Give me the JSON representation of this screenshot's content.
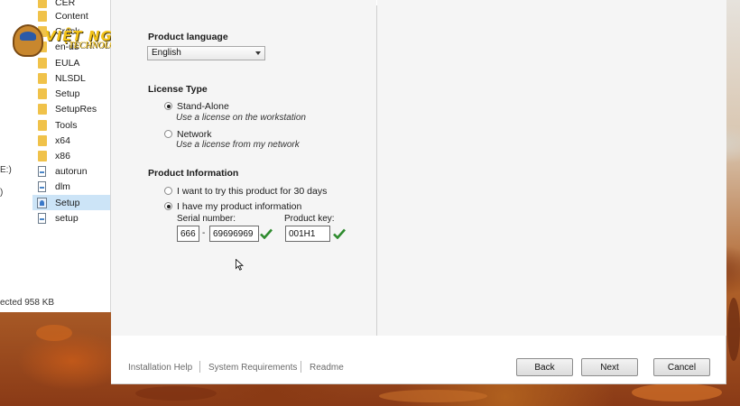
{
  "explorer": {
    "items": [
      {
        "label": "CER",
        "icon": "folder-icon"
      },
      {
        "label": "Content",
        "icon": "folder-icon"
      },
      {
        "label": "Crack",
        "icon": "folder-icon"
      },
      {
        "label": "en-us",
        "icon": "folder-icon"
      },
      {
        "label": "EULA",
        "icon": "folder-icon"
      },
      {
        "label": "NLSDL",
        "icon": "folder-icon"
      },
      {
        "label": "Setup",
        "icon": "folder-icon"
      },
      {
        "label": "SetupRes",
        "icon": "folder-icon"
      },
      {
        "label": "Tools",
        "icon": "folder-icon"
      },
      {
        "label": "x64",
        "icon": "folder-icon"
      },
      {
        "label": "x86",
        "icon": "folder-icon"
      },
      {
        "label": "autorun",
        "icon": "document-icon"
      },
      {
        "label": "dlm",
        "icon": "document-icon"
      },
      {
        "label": "Setup",
        "icon": "setup-app-icon"
      },
      {
        "label": "setup",
        "icon": "document-icon"
      }
    ],
    "selected_item": "Setup",
    "edge_marks": [
      "E:)",
      ")"
    ],
    "status": "ected  958 KB"
  },
  "watermark": {
    "top": "VIỆT NGÀY",
    "bottom": "TECHNOLOGY"
  },
  "installer": {
    "product_language": {
      "title": "Product language",
      "selected": "English"
    },
    "license_type": {
      "title": "License Type",
      "options": [
        {
          "label": "Stand-Alone",
          "description": "Use a license on the workstation",
          "checked": true
        },
        {
          "label": "Network",
          "description": "Use a license from my network",
          "checked": false
        }
      ]
    },
    "product_information": {
      "title": "Product Information",
      "options": [
        {
          "label": "I want to try this product for 30 days",
          "checked": false
        },
        {
          "label": "I have my product information",
          "checked": true
        }
      ],
      "serial_label": "Serial number:",
      "serial_prefix": "666",
      "serial_dash": "-",
      "serial_number": "69696969",
      "product_key_label": "Product key:",
      "product_key": "001H1"
    },
    "footer": {
      "links": [
        "Installation Help",
        "System Requirements",
        "Readme"
      ],
      "buttons": {
        "back": "Back",
        "next": "Next",
        "cancel": "Cancel"
      }
    },
    "colors": {
      "check": "#2e8b2e",
      "folder": "#f0c24a"
    }
  }
}
